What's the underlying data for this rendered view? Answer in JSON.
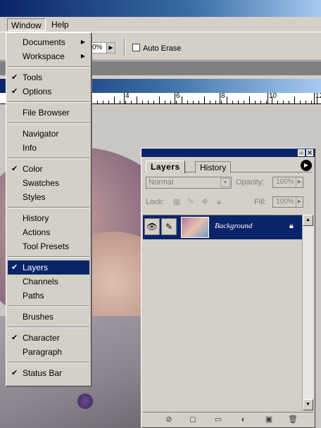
{
  "menubar": {
    "window": "Window",
    "help": "Help"
  },
  "options": {
    "opacity_value": "0%",
    "auto_erase_label": "Auto Erase"
  },
  "ruler": {
    "labels": [
      "4",
      "6",
      "8",
      "10",
      "12"
    ]
  },
  "window_menu": {
    "items": [
      {
        "label": "Documents",
        "checked": false,
        "submenu": true
      },
      {
        "label": "Workspace",
        "checked": false,
        "submenu": true
      },
      {
        "label": "Tools",
        "checked": true,
        "submenu": false
      },
      {
        "label": "Options",
        "checked": true,
        "submenu": false
      },
      {
        "label": "File Browser",
        "checked": false,
        "submenu": false
      },
      {
        "label": "Navigator",
        "checked": false,
        "submenu": false
      },
      {
        "label": "Info",
        "checked": false,
        "submenu": false
      },
      {
        "label": "Color",
        "checked": true,
        "submenu": false
      },
      {
        "label": "Swatches",
        "checked": false,
        "submenu": false
      },
      {
        "label": "Styles",
        "checked": false,
        "submenu": false
      },
      {
        "label": "History",
        "checked": false,
        "submenu": false
      },
      {
        "label": "Actions",
        "checked": false,
        "submenu": false
      },
      {
        "label": "Tool Presets",
        "checked": false,
        "submenu": false
      },
      {
        "label": "Layers",
        "checked": true,
        "submenu": false,
        "selected": true
      },
      {
        "label": "Channels",
        "checked": false,
        "submenu": false
      },
      {
        "label": "Paths",
        "checked": false,
        "submenu": false
      },
      {
        "label": "Brushes",
        "checked": false,
        "submenu": false
      },
      {
        "label": "Character",
        "checked": true,
        "submenu": false
      },
      {
        "label": "Paragraph",
        "checked": false,
        "submenu": false
      },
      {
        "label": "Status Bar",
        "checked": true,
        "submenu": false
      }
    ]
  },
  "layers_palette": {
    "tab_active": "Layers",
    "tab_inactive": "History",
    "blend_mode": "Normal",
    "opacity_label": "Opacity:",
    "opacity_value": "100%",
    "lock_label": "Lock:",
    "fill_label": "Fill:",
    "fill_value": "100%",
    "layer_name": "Background"
  },
  "colors": {
    "selection": "#0a246a",
    "chrome": "#d4d0c8"
  }
}
